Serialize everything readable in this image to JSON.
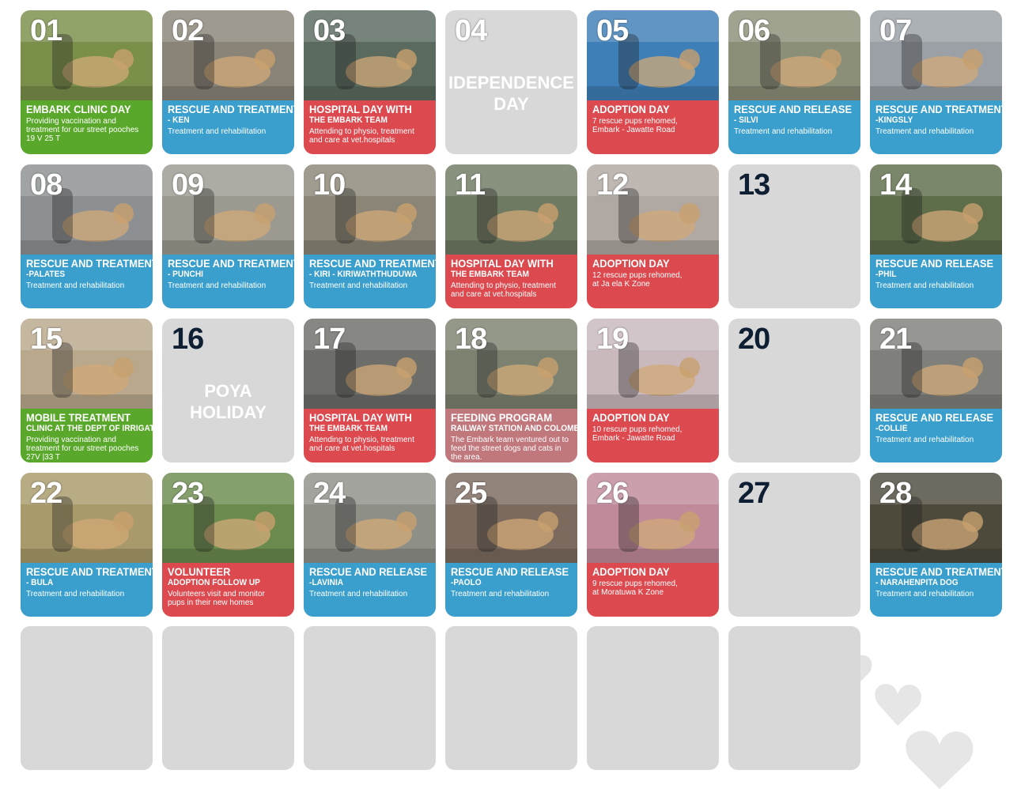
{
  "days": [
    {
      "num": "01",
      "color": "green",
      "title": "EMBARK CLINIC DAY",
      "subtitle": "",
      "desc": "Providing vaccination and\ntreatment for our street pooches\n19 V 25 T",
      "photo": "#7a8f4a"
    },
    {
      "num": "02",
      "color": "blue",
      "title": "RESCUE AND TREATMENT",
      "subtitle": "- KEN",
      "desc": "Treatment and rehabilitation",
      "photo": "#8a8478"
    },
    {
      "num": "03",
      "color": "red",
      "title": "HOSPITAL DAY WITH",
      "subtitle": "THE EMBARK TEAM",
      "desc": "Attending to physio, treatment\nand care at vet.hospitals",
      "photo": "#5a6a5e"
    },
    {
      "num": "04",
      "color": "none",
      "holiday": "IDEPENDENCE\nDAY"
    },
    {
      "num": "05",
      "color": "red",
      "title": "ADOPTION DAY",
      "subtitle": "",
      "desc": "7 rescue pups rehomed,\nEmbark - Jawatte Road",
      "photo": "#3f7fb8"
    },
    {
      "num": "06",
      "color": "blue",
      "title": "RESCUE AND RELEASE",
      "subtitle": " -  SILVI",
      "desc": "Treatment and rehabilitation",
      "photo": "#8c8f78"
    },
    {
      "num": "07",
      "color": "blue",
      "title": "RESCUE AND TREATMENT",
      "subtitle": "-KINGSLY",
      "desc": "Treatment and rehabilitation",
      "photo": "#9aa0a6"
    },
    {
      "num": "08",
      "color": "blue",
      "title": "RESCUE AND TREATMENT",
      "subtitle": "-PALATES",
      "desc": "Treatment and rehabilitation",
      "photo": "#8d9092"
    },
    {
      "num": "09",
      "color": "blue",
      "title": "RESCUE AND TREATMENT",
      "subtitle": "- PUNCHI",
      "desc": "Treatment and rehabilitation",
      "photo": "#9c9a90"
    },
    {
      "num": "10",
      "color": "blue",
      "title": "RESCUE AND TREATMENT",
      "subtitle": "- KIRI - KIRIWATHTHUDUWA",
      "desc": "Treatment and rehabilitation",
      "photo": "#8a8576"
    },
    {
      "num": "11",
      "color": "red",
      "title": "HOSPITAL DAY WITH",
      "subtitle": "THE EMBARK TEAM",
      "desc": "Attending to physio, treatment\nand care at vet.hospitals",
      "photo": "#6f7a62"
    },
    {
      "num": "12",
      "color": "red",
      "title": "ADOPTION DAY",
      "subtitle": "",
      "desc": "12 rescue pups rehomed,\nat Ja ela K Zone",
      "photo": "#b0a8a2"
    },
    {
      "num": "13",
      "color": "none"
    },
    {
      "num": "14",
      "color": "blue",
      "title": "RESCUE AND RELEASE",
      "subtitle": "-PHIL",
      "desc": "Treatment and rehabilitation",
      "photo": "#5d6d4a"
    },
    {
      "num": "15",
      "color": "green",
      "title": "MOBILE TREATMENT",
      "subtitle": "CLINIC AT THE DEPT OF IRRIGATION",
      "desc": "Providing vaccination and\ntreatment for our street pooches\n27V |33 T",
      "photo": "#b9a88c"
    },
    {
      "num": "16",
      "color": "none",
      "holiday": "POYA\nHOLIDAY"
    },
    {
      "num": "17",
      "color": "red",
      "title": "HOSPITAL DAY WITH",
      "subtitle": "THE EMBARK TEAM",
      "desc": "Attending to physio, treatment\nand care at vet.hospitals",
      "photo": "#6d6e6a"
    },
    {
      "num": "18",
      "color": "mauve",
      "title": "FEEDING PROGRAM",
      "subtitle": "RAILWAY STATION AND COLOMBO",
      "desc": "The Embark team ventured out to\nfeed the street dogs and cats in\nthe area.",
      "photo": "#7d8270"
    },
    {
      "num": "19",
      "color": "red",
      "title": "ADOPTION DAY",
      "subtitle": "",
      "desc": "10 rescue pups rehomed,\nEmbark - Jawatte Road",
      "photo": "#c9b9bd"
    },
    {
      "num": "20",
      "color": "none"
    },
    {
      "num": "21",
      "color": "blue",
      "title": "RESCUE AND RELEASE",
      "subtitle": "-COLLIE",
      "desc": "Treatment and rehabilitation",
      "photo": "#7f807c"
    },
    {
      "num": "22",
      "color": "blue",
      "title": "RESCUE AND TREATMENT",
      "subtitle": "- BULA",
      "desc": "Treatment and rehabilitation",
      "photo": "#a89a6a"
    },
    {
      "num": "23",
      "color": "red",
      "title": "VOLUNTEER",
      "subtitle": "ADOPTION FOLLOW UP",
      "desc": "Volunteers visit and monitor\npups in their new homes",
      "photo": "#6b8a4e"
    },
    {
      "num": "24",
      "color": "blue",
      "title": "RESCUE AND RELEASE",
      "subtitle": "-LAVINIA",
      "desc": "Treatment and rehabilitation",
      "photo": "#8e9088"
    },
    {
      "num": "25",
      "color": "blue",
      "title": "RESCUE AND RELEASE",
      "subtitle": "-PAOLO",
      "desc": "Treatment and rehabilitation",
      "photo": "#7c6a5e"
    },
    {
      "num": "26",
      "color": "red",
      "title": "ADOPTION DAY",
      "subtitle": "",
      "desc": "9 rescue pups rehomed,\nat Moratuwa K Zone",
      "photo": "#c08a9a"
    },
    {
      "num": "27",
      "color": "none"
    },
    {
      "num": "28",
      "color": "blue",
      "title": "RESCUE AND TREATMENT",
      "subtitle": " -  NARAHENPITA DOG",
      "desc": "Treatment and rehabilitation",
      "photo": "#4d4a3c"
    },
    {
      "num": "",
      "color": "none"
    },
    {
      "num": "",
      "color": "none"
    },
    {
      "num": "",
      "color": "none"
    },
    {
      "num": "",
      "color": "none"
    },
    {
      "num": "",
      "color": "none"
    },
    {
      "num": "",
      "color": "none"
    }
  ]
}
